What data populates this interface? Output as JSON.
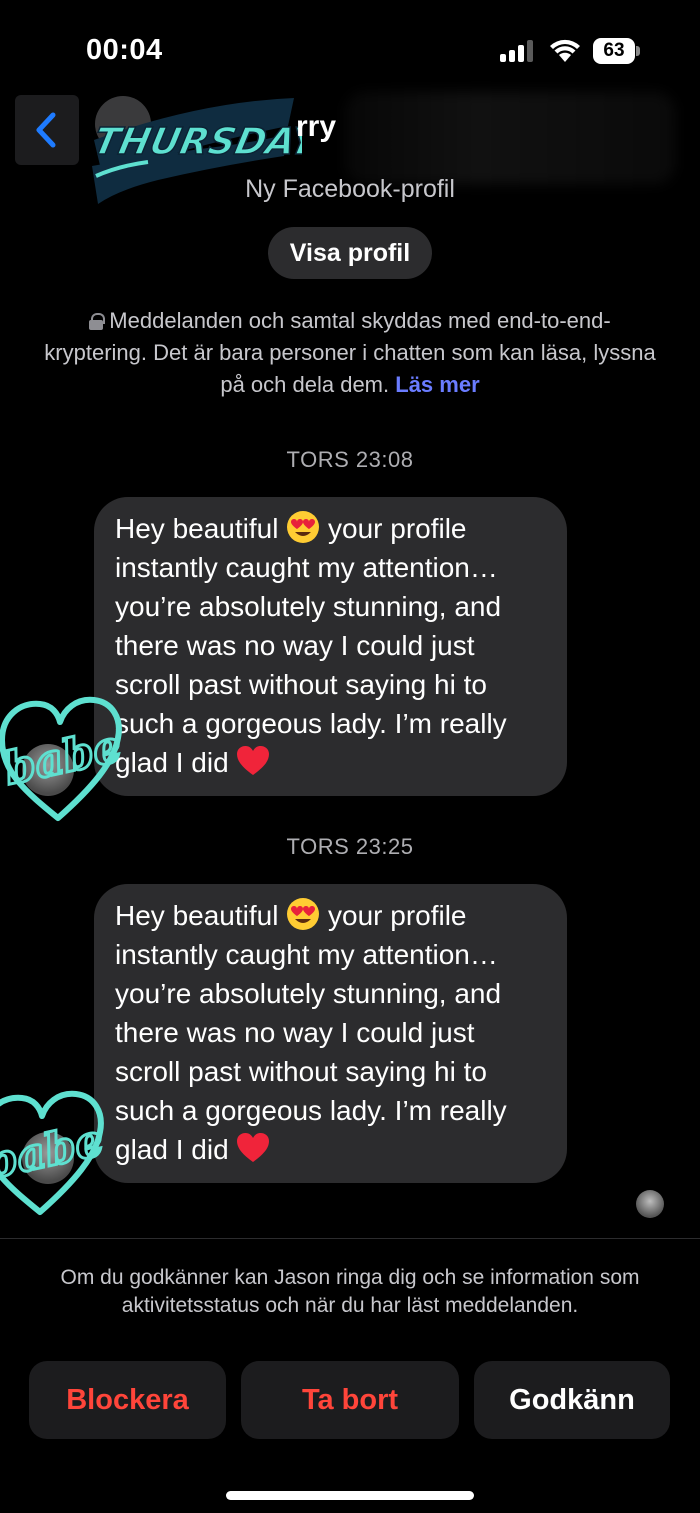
{
  "status_bar": {
    "time": "00:04",
    "battery": "63"
  },
  "header": {
    "name_partial": "rry",
    "profile_subtitle": "Ny Facebook-profil",
    "view_profile_label": "Visa profil",
    "sticker_text": "THURSDAY"
  },
  "encryption_notice": {
    "text": "Meddelanden och samtal skyddas med end-to-end-kryptering. Det är bara personer i chatten som kan läsa, lyssna på och dela dem.",
    "link": "Läs mer"
  },
  "messages": [
    {
      "timestamp": "TORS 23:08",
      "lines": [
        "Hey beautiful",
        " your profile",
        "instantly caught my attention…",
        "you’re absolutely stunning, and",
        "there was no way I could just",
        "scroll past without saying hi to",
        "such a gorgeous lady. I’m really",
        "glad I did"
      ]
    },
    {
      "timestamp": "TORS 23:25",
      "lines": [
        "Hey beautiful",
        " your profile",
        "instantly caught my attention…",
        "you’re absolutely stunning, and",
        "there was no way I could just",
        "scroll past without saying hi to",
        "such a gorgeous lady. I’m really",
        "glad I did"
      ]
    }
  ],
  "sticker_babe_text": "babe",
  "consent": {
    "text": "Om du godkänner kan Jason ringa dig och se information som aktivitetsstatus och när du har läst meddelanden."
  },
  "actions": {
    "block": "Blockera",
    "delete": "Ta bort",
    "accept": "Godkänn"
  },
  "colors": {
    "background": "#000000",
    "bubble": "#2c2c2e",
    "link": "#6a7cff",
    "danger": "#ff453a",
    "sticker_teal": "#5ee0d0"
  },
  "icons": [
    "back-chevron-icon",
    "lock-icon",
    "signal-icon",
    "wifi-icon",
    "battery-icon",
    "heart-eyes-emoji",
    "red-heart-emoji"
  ]
}
